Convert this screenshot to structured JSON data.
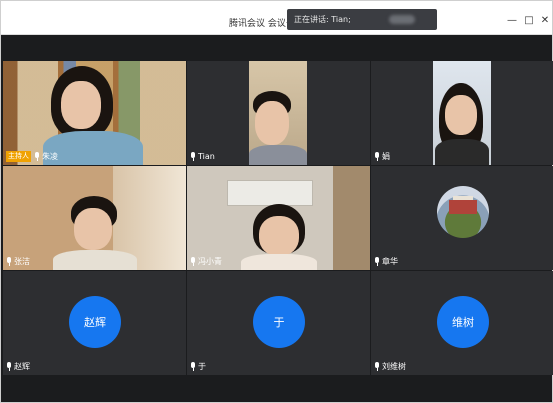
{
  "window": {
    "title": "腾讯会议 会议号：",
    "speaking_text": "正在讲话: Tian;",
    "controls": [
      "—",
      "□",
      "✕"
    ]
  },
  "participants": [
    {
      "name": "朱凌",
      "host_badge": "主持人",
      "video": true
    },
    {
      "name": "Tian",
      "video": true
    },
    {
      "name": "娟",
      "video": true
    },
    {
      "name": "张洁",
      "video": true
    },
    {
      "name": "冯小青",
      "video": true
    },
    {
      "name": "章华",
      "video": false,
      "photo_avatar": true
    },
    {
      "name": "赵辉",
      "avatar_text": "赵辉",
      "video": false
    },
    {
      "name": "于",
      "avatar_text": "于",
      "video": false
    },
    {
      "name": "刘维树",
      "avatar_text": "维树",
      "video": false
    }
  ],
  "colors": {
    "avatar_blue": "#1677f0",
    "host_badge": "#f0a202",
    "stage_bg": "#1b1c1e",
    "tile_bg": "#2d2e31"
  },
  "icons": {
    "mic": "mic-icon",
    "minimize": "minimize-icon",
    "maximize": "maximize-icon",
    "close": "close-icon"
  }
}
